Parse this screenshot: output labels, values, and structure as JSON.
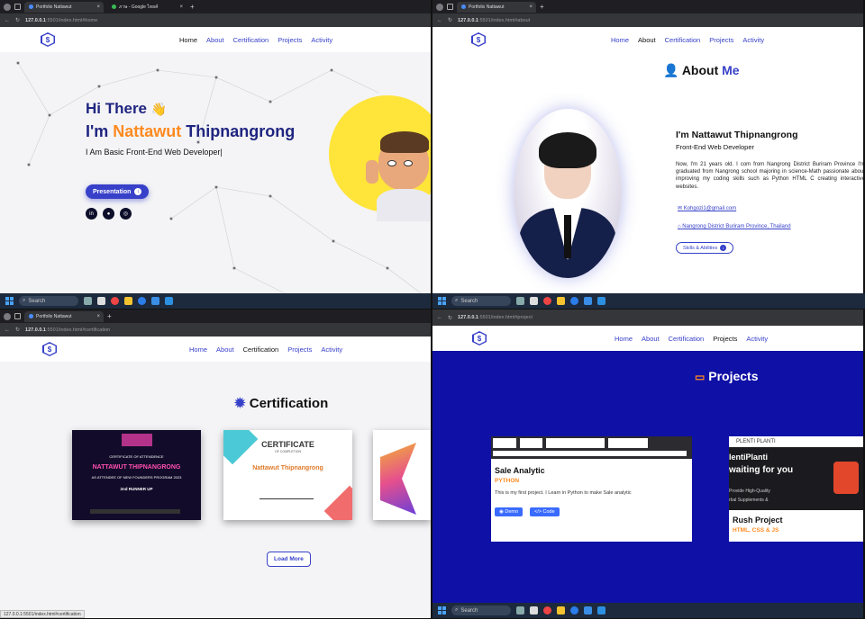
{
  "q1": {
    "tabs": [
      {
        "title": "Portfolio Nattawut"
      },
      {
        "title": "ภาษ - Google ไทยค้"
      }
    ],
    "url": {
      "host": "127.0.0.1",
      "rest": ":5501/index.html#home"
    },
    "nav": {
      "links": [
        "Home",
        "About",
        "Certification",
        "Projects",
        "Activity"
      ],
      "active": "Home"
    },
    "hero": {
      "hi": "Hi There",
      "wave": "👋",
      "im_prefix": "I'm ",
      "first": "Nattawut",
      "last": " Thipnangrong",
      "role": "I Am Basic Front-End Web Developer|",
      "button": "Presentation"
    }
  },
  "q2": {
    "tabs": [
      {
        "title": "Portfolio Nattawut"
      }
    ],
    "url": {
      "host": "127.0.0.1",
      "rest": ":5501/index.html#about"
    },
    "nav": {
      "links": [
        "Home",
        "About",
        "Certification",
        "Projects",
        "Activity"
      ],
      "active": "About"
    },
    "about": {
      "title_a": "About ",
      "title_b": "Me",
      "name": "I'm Nattawut Thipnangrong",
      "role": "Front-End Web Developer",
      "desc": "Now, I'm 21 years old. I com from Nangrong District Buriram Province I'm graduated from Nangrong school majoring in science-Math passionate about improving my coding skills such as Python HTML C creating interactive websites.",
      "email": "Kohgozi1@gmail.com",
      "location": "Nangrong District Buriram Province, Thailand",
      "button": "Skills & Abilities"
    }
  },
  "q3": {
    "tabs": [
      {
        "title": "Portfolio Nattawut"
      }
    ],
    "url": {
      "host": "127.0.0.1",
      "rest": ":5501/index.html#certification"
    },
    "nav": {
      "links": [
        "Home",
        "About",
        "Certification",
        "Projects",
        "Activity"
      ],
      "active": "Certification"
    },
    "title": "Certification",
    "cert1": {
      "head": "CERTIFICATE OF ATTENDENCE",
      "name": "NATTAWUT THIPNANGRONG",
      "line": "AS ATTENDEE OF NEW FOUNDERS PROGRAM 2023",
      "award": "2nd RUNNER UP"
    },
    "cert2": {
      "head": "CERTIFICATE",
      "sub": "OF COMPLETION",
      "name": "Nattawut Thipnangrong"
    },
    "load_more": "Load More",
    "status": "127.0.0.1:5501/index.html#certification"
  },
  "q4": {
    "url": {
      "host": "127.0.0.1",
      "rest": ":5501/index.html#project"
    },
    "nav": {
      "links": [
        "Home",
        "About",
        "Certification",
        "Projects",
        "Activity"
      ],
      "active": "Projects"
    },
    "title": "Projects",
    "p1": {
      "name": "Sale Analytic",
      "tag": "PYTHON",
      "desc": "This is my first project. I Learn in Python to make Sale analytic",
      "demo": "Demo",
      "code": "Code"
    },
    "p2": {
      "brand": "PLENTI PLANTI",
      "hero": "lentiPlanti",
      "hero2": "waiting for you",
      "line1": "Provide High-Quality",
      "line2": "rbal Supplements &",
      "name": "Rush Project",
      "tag": "HTML, CSS & JS"
    }
  },
  "taskbar": {
    "search": "Search"
  }
}
